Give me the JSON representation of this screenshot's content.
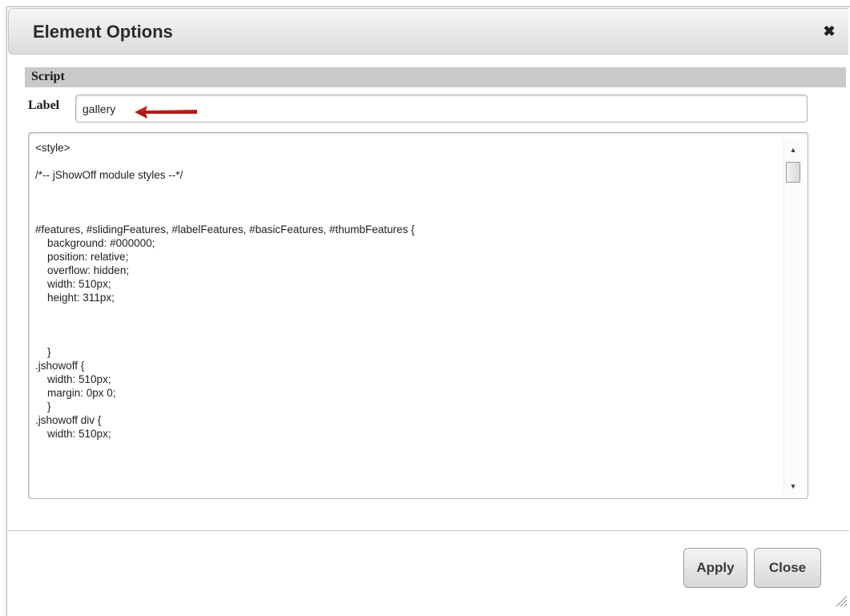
{
  "dialog": {
    "title": "Element Options",
    "close_icon": "close-icon",
    "section_title": "Script",
    "label_text": "Label",
    "label_value": "gallery",
    "script_lines": [
      "<style>",
      "",
      "/*-- jShowOff module styles --*/",
      "",
      "",
      "",
      "#features, #slidingFeatures, #labelFeatures, #basicFeatures, #thumbFeatures {",
      "\tbackground: #000000;",
      "\tposition: relative;",
      "\toverflow: hidden;",
      "\twidth: 510px;",
      "\theight: 311px;",
      "",
      "",
      "",
      "\t}",
      ".jshowoff {",
      "\twidth: 510px;",
      "\tmargin: 0px 0;",
      "\t}",
      ".jshowoff div {",
      "\twidth: 510px;"
    ],
    "buttons": {
      "apply": "Apply",
      "close": "Close"
    },
    "colors": {
      "arrow": "#b01010",
      "section_bg": "#c9c9c9"
    }
  }
}
